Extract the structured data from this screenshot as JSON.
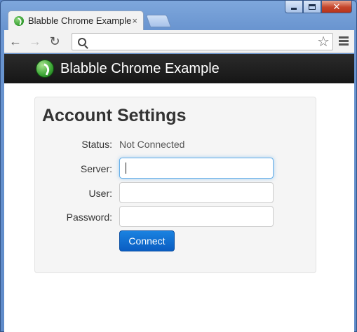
{
  "browser": {
    "tab_title": "Blabble Chrome Example",
    "tab_close": "×",
    "address_value": "",
    "back_glyph": "←",
    "forward_glyph": "→",
    "reload_glyph": "↻",
    "star_glyph": "☆"
  },
  "icons": {
    "favicon": "blabble-logo-icon",
    "brand": "blabble-logo-icon",
    "search": "search-icon",
    "star": "bookmark-star-icon",
    "menu": "hamburger-menu-icon"
  },
  "app": {
    "brand": "Blabble Chrome Example"
  },
  "settings": {
    "title": "Account Settings",
    "status_label": "Status:",
    "status_value": "Not Connected",
    "server_label": "Server:",
    "server_value": "",
    "user_label": "User:",
    "user_value": "",
    "password_label": "Password:",
    "password_value": "",
    "connect_label": "Connect"
  },
  "colors": {
    "navbar": "#1f1f1f",
    "button": "#0a6ad6",
    "brand_green": "#3aa534"
  }
}
